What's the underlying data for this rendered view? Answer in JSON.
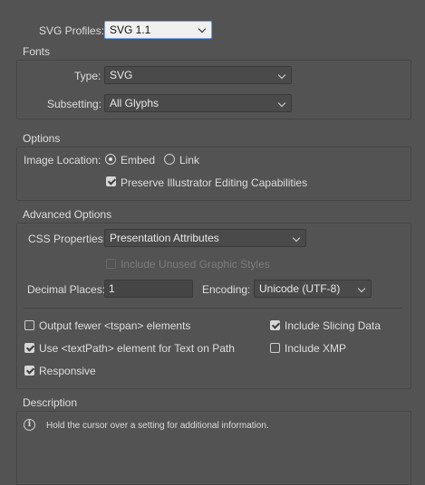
{
  "svg_profiles": {
    "label": "SVG Profiles:",
    "value": "SVG 1.1"
  },
  "fonts": {
    "title": "Fonts",
    "type_label": "Type:",
    "type_value": "SVG",
    "subsetting_label": "Subsetting:",
    "subsetting_value": "All Glyphs"
  },
  "options": {
    "title": "Options",
    "image_location_label": "Image Location:",
    "embed_label": "Embed",
    "link_label": "Link",
    "embed_selected": true,
    "preserve_label": "Preserve Illustrator Editing Capabilities",
    "preserve_checked": true
  },
  "advanced": {
    "title": "Advanced Options",
    "css_label": "CSS Properties:",
    "css_value": "Presentation Attributes",
    "include_unused_label": "Include Unused Graphic Styles",
    "decimal_label": "Decimal Places:",
    "decimal_value": "1",
    "encoding_label": "Encoding:",
    "encoding_value": "Unicode (UTF-8)",
    "output_fewer_label": "Output fewer <tspan> elements",
    "include_slicing_label": "Include Slicing Data",
    "use_textpath_label": "Use <textPath> element for Text on Path",
    "include_xmp_label": "Include XMP",
    "responsive_label": "Responsive"
  },
  "description": {
    "title": "Description",
    "text": "Hold the cursor over a setting for additional information."
  }
}
